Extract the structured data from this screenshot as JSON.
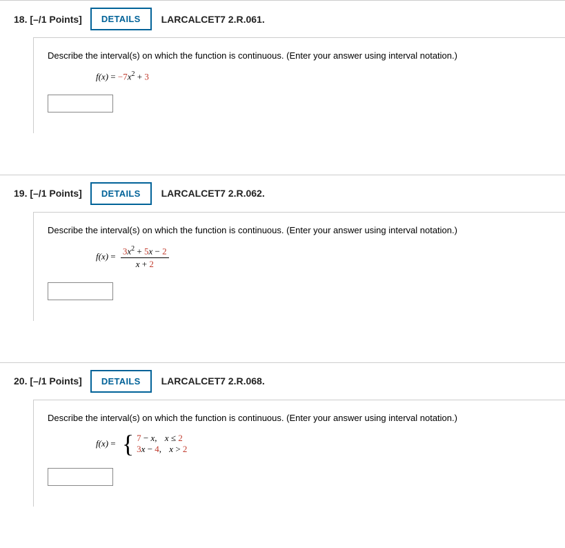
{
  "questions": [
    {
      "number": "18.",
      "points": "[–/1 Points]",
      "details": "DETAILS",
      "source": "LARCALCET7 2.R.061.",
      "prompt": "Describe the interval(s) on which the function is continuous. (Enter your answer using interval notation.)",
      "formula": {
        "lhs": "f(x)",
        "eq": "=",
        "c1": "−7",
        "var1": "x",
        "sup1": "2",
        "op1": "+",
        "c2": "3"
      },
      "answer": ""
    },
    {
      "number": "19.",
      "points": "[–/1 Points]",
      "details": "DETAILS",
      "source": "LARCALCET7 2.R.062.",
      "prompt": "Describe the interval(s) on which the function is continuous. (Enter your answer using interval notation.)",
      "formula": {
        "lhs": "f(x)",
        "eq": "=",
        "num_c1": "3",
        "num_v1": "x",
        "num_sup1": "2",
        "num_op1": "+",
        "num_c2": "5",
        "num_v2": "x",
        "num_op2": "−",
        "num_c3": "2",
        "den_v1": "x",
        "den_op1": "+",
        "den_c1": "2"
      },
      "answer": ""
    },
    {
      "number": "20.",
      "points": "[–/1 Points]",
      "details": "DETAILS",
      "source": "LARCALCET7 2.R.068.",
      "prompt": "Describe the interval(s) on which the function is continuous. (Enter your answer using interval notation.)",
      "formula": {
        "lhs": "f(x)",
        "eq": "=",
        "r1_c1": "7",
        "r1_op1": "−",
        "r1_v1": "x",
        "r1_comma": ",",
        "r1_cond_v": "x",
        "r1_cond_op": "≤",
        "r1_cond_c": "2",
        "r2_c1": "3",
        "r2_v1": "x",
        "r2_op1": "−",
        "r2_c2": "4",
        "r2_comma": ",",
        "r2_cond_v": "x",
        "r2_cond_op": ">",
        "r2_cond_c": "2"
      },
      "answer": ""
    }
  ]
}
